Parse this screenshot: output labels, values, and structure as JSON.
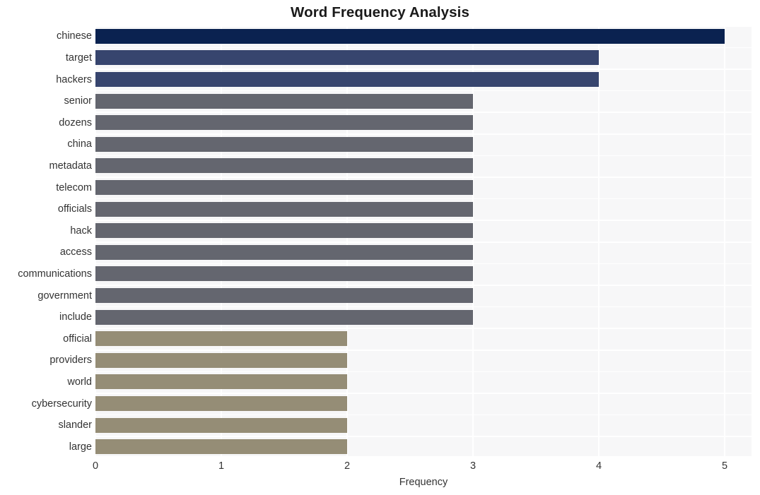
{
  "chart_data": {
    "type": "bar",
    "orientation": "horizontal",
    "title": "Word Frequency Analysis",
    "xlabel": "Frequency",
    "ylabel": "",
    "xlim": [
      0,
      5.2
    ],
    "xticks": [
      0,
      1,
      2,
      3,
      4,
      5
    ],
    "xtick_labels": [
      "0",
      "1",
      "2",
      "3",
      "4",
      "5"
    ],
    "grid": true,
    "legend": false,
    "categories": [
      "chinese",
      "target",
      "hackers",
      "senior",
      "dozens",
      "china",
      "metadata",
      "telecom",
      "officials",
      "hack",
      "access",
      "communications",
      "government",
      "include",
      "official",
      "providers",
      "world",
      "cybersecurity",
      "slander",
      "large"
    ],
    "values": [
      5,
      4,
      4,
      3,
      3,
      3,
      3,
      3,
      3,
      3,
      3,
      3,
      3,
      3,
      2,
      2,
      2,
      2,
      2,
      2
    ],
    "bar_colors": [
      "#0a2250",
      "#37456e",
      "#37456e",
      "#64666f",
      "#64666f",
      "#64666f",
      "#64666f",
      "#64666f",
      "#64666f",
      "#64666f",
      "#64666f",
      "#64666f",
      "#64666f",
      "#64666f",
      "#958d76",
      "#958d76",
      "#958d76",
      "#958d76",
      "#958d76",
      "#958d76"
    ]
  },
  "style": {
    "plot_background": "#f7f7f8",
    "figure_background": "#ffffff",
    "grid_color": "#ffffff",
    "text_color": "#333333",
    "title_color": "#1a1a1a"
  }
}
